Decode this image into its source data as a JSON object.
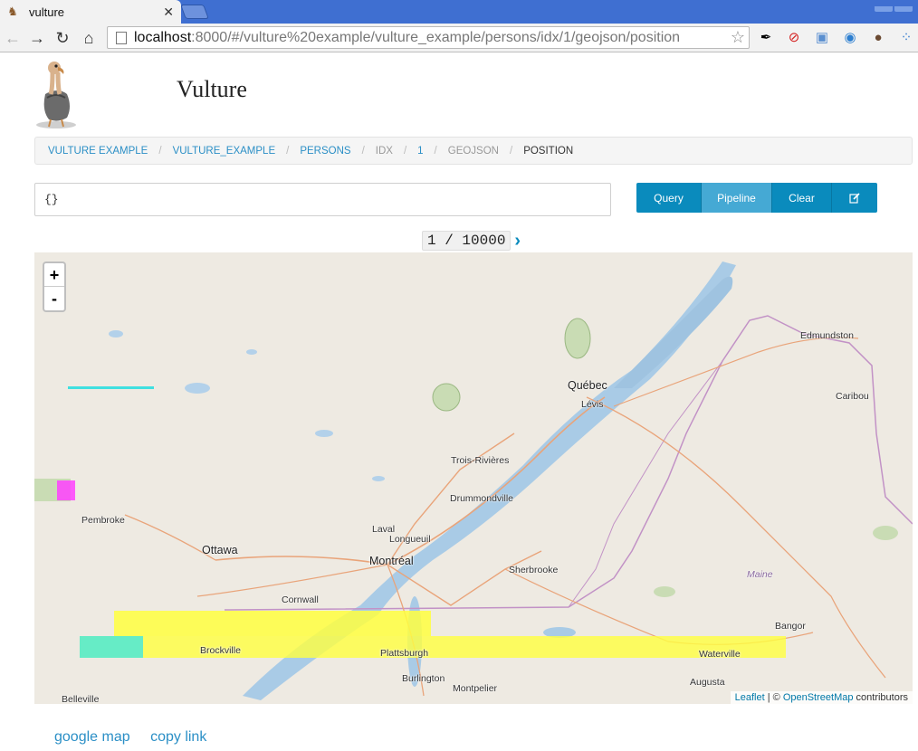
{
  "browser": {
    "tab_title": "vulture",
    "url_host": "localhost",
    "url_rest": ":8000/#/vulture%20example/vulture_example/persons/idx/1/geojson/position"
  },
  "app": {
    "title": "Vulture"
  },
  "breadcrumb": [
    "VULTURE EXAMPLE",
    "VULTURE_EXAMPLE",
    "PERSONS",
    "IDX",
    "1",
    "GEOJSON",
    "POSITION"
  ],
  "query": {
    "value": "{}"
  },
  "buttons": {
    "query": "Query",
    "pipeline": "Pipeline",
    "clear": "Clear"
  },
  "pager": {
    "label": "1 / 10000"
  },
  "map": {
    "zoom_in": "+",
    "zoom_out": "-",
    "attribution": {
      "leaflet": "Leaflet",
      "sep": " | © ",
      "osm": "OpenStreetMap",
      "tail": " contributors"
    },
    "places": {
      "quebec": "Québec",
      "levis": "Lévis",
      "edmundston": "Edmundston",
      "caribou": "Caribou",
      "trois_rivieres": "Trois-Rivières",
      "drummondville": "Drummondville",
      "pembroke": "Pembroke",
      "laval": "Laval",
      "longueuil": "Longueuil",
      "ottawa": "Ottawa",
      "montreal": "Montréal",
      "sherbrooke": "Sherbrooke",
      "maine": "Maine",
      "cornwall": "Cornwall",
      "bangor": "Bangor",
      "brockville": "Brockville",
      "plattsburgh": "Plattsburgh",
      "waterville": "Waterville",
      "burlington": "Burlington",
      "montpelier": "Montpelier",
      "augusta": "Augusta",
      "belleville": "Belleville"
    }
  },
  "footer": {
    "google_map": "google map",
    "copy_link": "copy link"
  }
}
